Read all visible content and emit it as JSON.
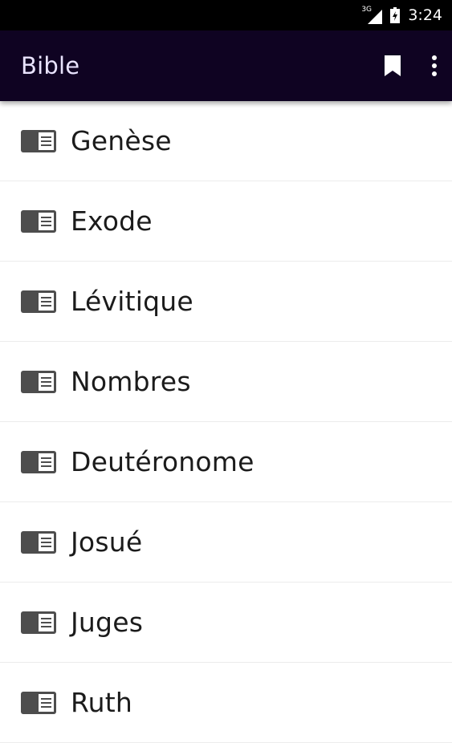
{
  "status_bar": {
    "network": "3G",
    "time": "3:24"
  },
  "app_bar": {
    "title": "Bible",
    "bookmark_icon": "bookmark-icon",
    "more_icon": "more-vert-icon",
    "background": "#0f0322",
    "title_color": "#e9e3ff"
  },
  "books": [
    {
      "label": "Genèse",
      "icon": "book-icon"
    },
    {
      "label": "Exode",
      "icon": "book-icon"
    },
    {
      "label": "Lévitique",
      "icon": "book-icon"
    },
    {
      "label": "Nombres",
      "icon": "book-icon"
    },
    {
      "label": "Deutéronome",
      "icon": "book-icon"
    },
    {
      "label": "Josué",
      "icon": "book-icon"
    },
    {
      "label": "Juges",
      "icon": "book-icon"
    },
    {
      "label": "Ruth",
      "icon": "book-icon"
    }
  ]
}
